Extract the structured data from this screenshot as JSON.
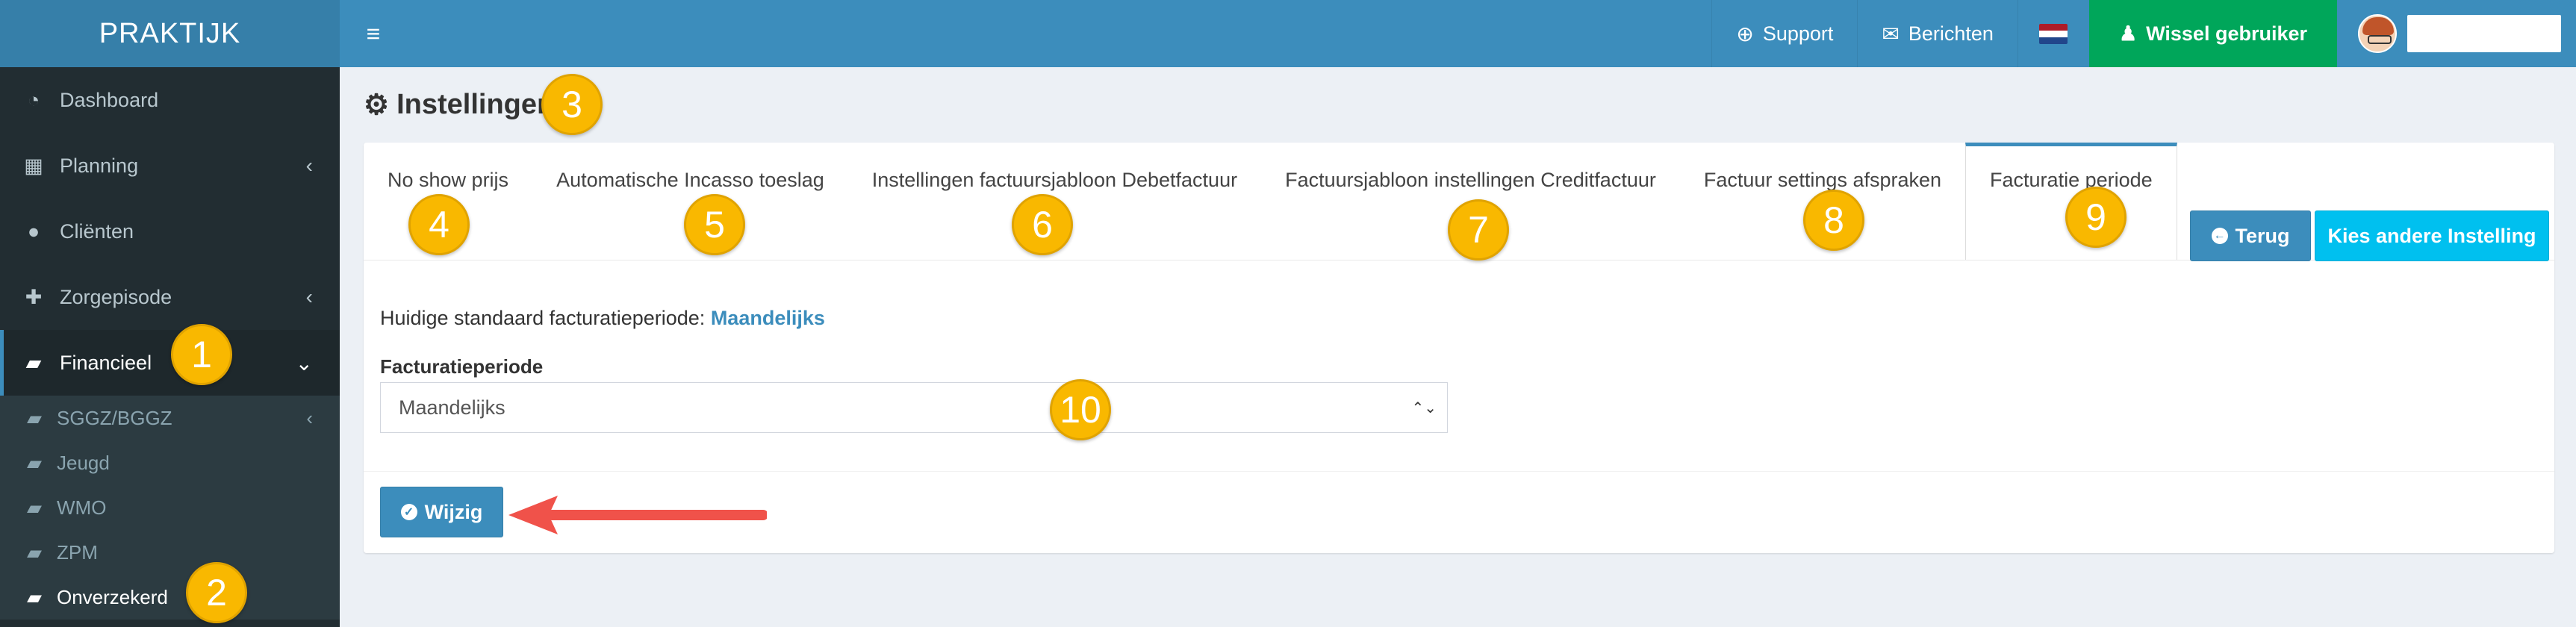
{
  "brand": "PRAKTIJK",
  "topbar": {
    "menu_icon": "hamburger-icon",
    "support_label": "Support",
    "messages_label": "Berichten",
    "switch_user_label": "Wissel gebruiker",
    "language": "nl",
    "flag_colors": [
      "#ae1c28",
      "#ffffff",
      "#21468b"
    ]
  },
  "sidebar": {
    "items": [
      {
        "label": "Dashboard",
        "icon": "dashboard-icon"
      },
      {
        "label": "Planning",
        "icon": "calendar-icon"
      },
      {
        "label": "Cliënten",
        "icon": "user-icon"
      },
      {
        "label": "Zorgepisode",
        "icon": "medkit-icon"
      },
      {
        "label": "Financieel",
        "icon": "book-icon"
      }
    ],
    "sub_items": [
      {
        "label": "SGGZ/BGGZ"
      },
      {
        "label": "Jeugd"
      },
      {
        "label": "WMO"
      },
      {
        "label": "ZPM"
      },
      {
        "label": "Onverzekerd"
      }
    ]
  },
  "page": {
    "title": "Instellingen",
    "tabs": [
      {
        "label": "No show prijs"
      },
      {
        "label": "Automatische Incasso toeslag"
      },
      {
        "label": "Instellingen factuursjabloon Debetfactuur"
      },
      {
        "label": "Factuursjabloon instellingen Creditfactuur"
      },
      {
        "label": "Factuur settings afspraken"
      },
      {
        "label": "Facturatie periode"
      }
    ],
    "back_label": "Terug",
    "other_setting_label": "Kies andere Instelling",
    "current_text": "Huidige standaard facturatieperiode:",
    "current_value": "Maandelijks",
    "field_label": "Facturatieperiode",
    "select_value": "Maandelijks",
    "save_label": "Wijzig"
  },
  "markers": [
    "1",
    "2",
    "3",
    "4",
    "5",
    "6",
    "7",
    "8",
    "9",
    "10"
  ],
  "colors": {
    "accent": "#3c8dbc",
    "sidebar": "#222d32",
    "success": "#00a65a",
    "info": "#00c0ef",
    "marker": "#f9b800",
    "arrow": "#f0524a"
  }
}
